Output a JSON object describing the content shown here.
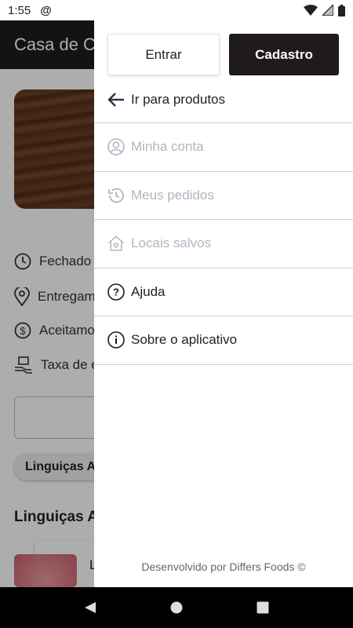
{
  "status_bar": {
    "time": "1:55",
    "at_icon": "at-sign-icon",
    "wifi_icon": "wifi-icon",
    "signal_icon": "signal-icon",
    "battery_icon": "battery-icon"
  },
  "app_bar": {
    "title": "Casa de Ca"
  },
  "background": {
    "info": [
      {
        "icon": "clock-icon",
        "text": "Fechado"
      },
      {
        "icon": "location-pin-icon",
        "text": "Entregam"
      },
      {
        "icon": "dollar-icon",
        "text": "Aceitamo"
      },
      {
        "icon": "delivery-icon",
        "text": "Taxa de e"
      }
    ],
    "chip": "Linguiças A",
    "section_title": "Linguiças A",
    "product_label": "L"
  },
  "drawer": {
    "login_label": "Entrar",
    "signup_label": "Cadastro",
    "items": [
      {
        "label": "Ir para produtos",
        "icon": "arrow-left-icon",
        "enabled": true
      },
      {
        "label": "Minha conta",
        "icon": "account-icon",
        "enabled": false
      },
      {
        "label": "Meus pedidos",
        "icon": "history-icon",
        "enabled": false
      },
      {
        "label": "Locais salvos",
        "icon": "home-heart-icon",
        "enabled": false
      },
      {
        "label": "Ajuda",
        "icon": "help-circle-icon",
        "enabled": true
      },
      {
        "label": "Sobre o aplicativo",
        "icon": "info-circle-icon",
        "enabled": true
      }
    ],
    "footer": "Desenvolvido por Differs Foods ©"
  },
  "colors": {
    "dark": "#1f1b1b",
    "disabled_text": "#aeb6c2",
    "divider": "#cfcfd4"
  }
}
